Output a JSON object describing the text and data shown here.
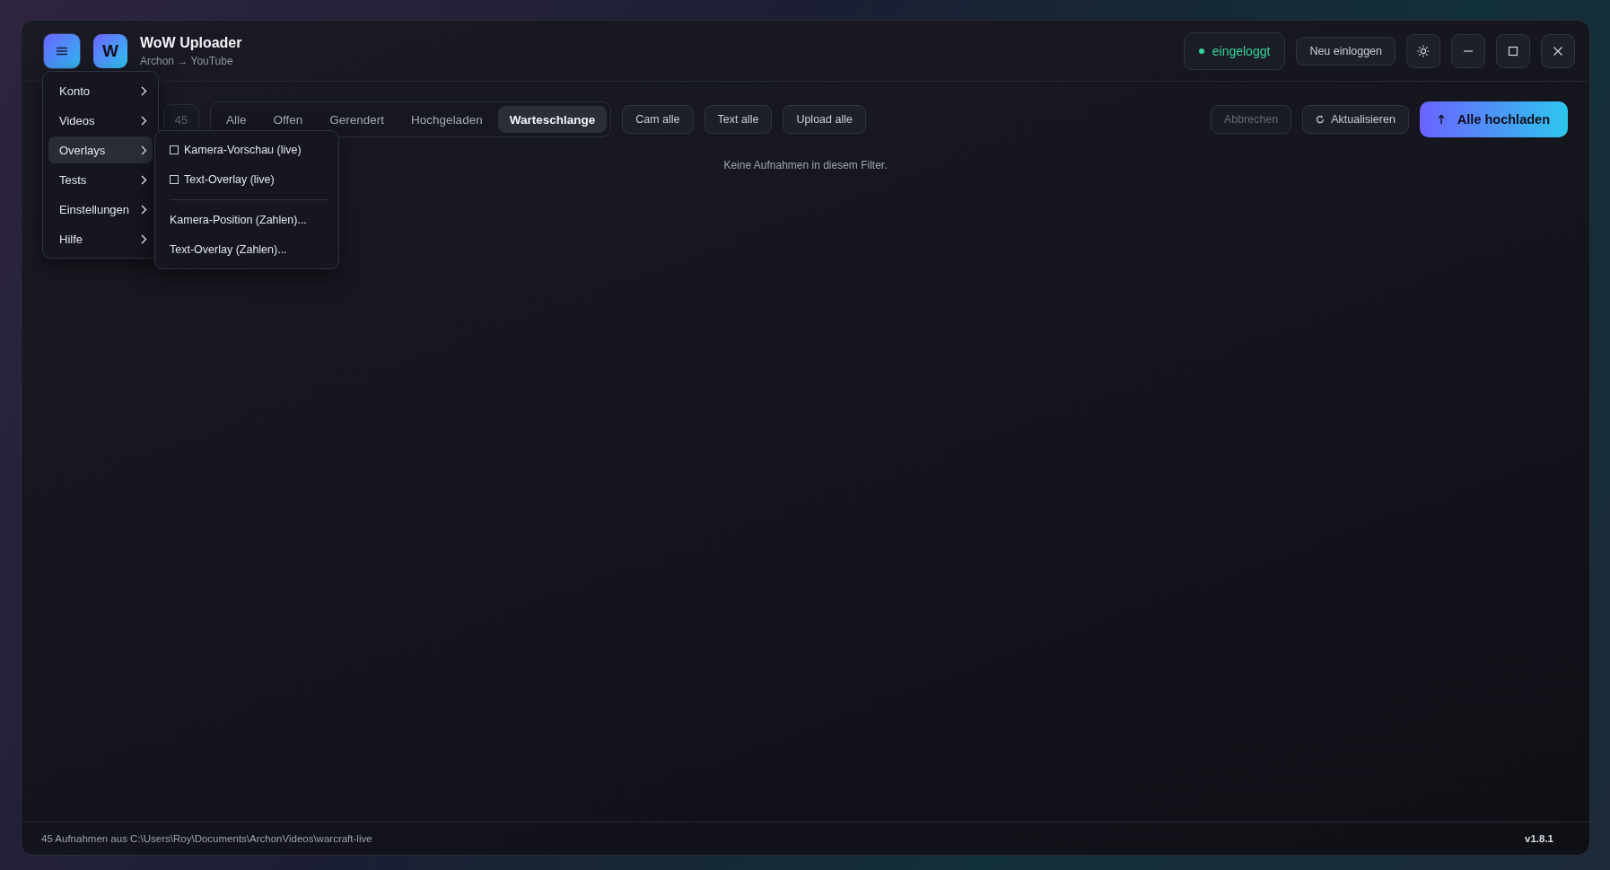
{
  "app": {
    "logo_letter": "W",
    "title": "WoW Uploader",
    "subtitle": "Archon → YouTube"
  },
  "header": {
    "status": {
      "label": "eingeloggt",
      "color": "#34d399"
    },
    "relogin": "Neu einloggen"
  },
  "menu": {
    "open": true,
    "items": [
      {
        "label": "Konto",
        "expanded": false
      },
      {
        "label": "Videos",
        "expanded": false
      },
      {
        "label": "Overlays",
        "expanded": true,
        "children": [
          {
            "kind": "check",
            "label": "Kamera-Vorschau (live)",
            "checked": false
          },
          {
            "kind": "check",
            "label": "Text-Overlay (live)",
            "checked": false
          },
          {
            "kind": "separator"
          },
          {
            "kind": "action",
            "label": "Kamera-Position (Zahlen)..."
          },
          {
            "kind": "action",
            "label": "Text-Overlay (Zahlen)..."
          }
        ]
      },
      {
        "label": "Tests",
        "expanded": false
      },
      {
        "label": "Einstellungen",
        "expanded": false
      },
      {
        "label": "Hilfe",
        "expanded": false
      }
    ]
  },
  "toolbar": {
    "count": "45",
    "tabs": [
      {
        "label": "Alle",
        "selected": false
      },
      {
        "label": "Offen",
        "selected": false
      },
      {
        "label": "Gerendert",
        "selected": false
      },
      {
        "label": "Hochgeladen",
        "selected": false
      },
      {
        "label": "Warteschlange",
        "selected": true
      }
    ],
    "bulk_buttons": [
      "Cam alle",
      "Text alle",
      "Upload alle"
    ],
    "cancel": {
      "label": "Abbrechen",
      "disabled": true
    },
    "refresh": "Aktualisieren",
    "upload_all": "Alle hochladen"
  },
  "empty_message": "Keine Aufnahmen in diesem Filter.",
  "status_bar": {
    "path": "45 Aufnahmen aus C:\\Users\\Roy\\Documents\\ArchonVideos\\warcraft-live",
    "version": "v1.8.1"
  }
}
